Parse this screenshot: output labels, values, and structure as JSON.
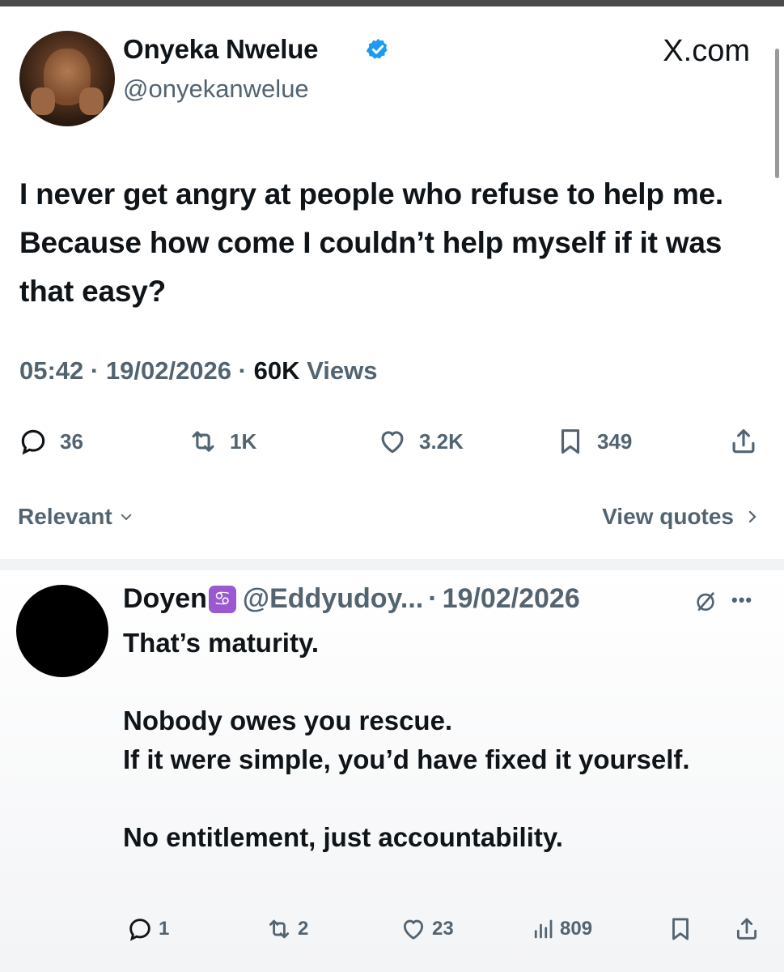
{
  "post": {
    "author_name": "Onyeka Nwelue",
    "handle": "@onyekanwelue",
    "site": "X.com",
    "text": "I never get angry at people who refuse to help me. Because how come I couldn’t help myself if it was that easy?",
    "time": "05:42",
    "date": "19/02/2026",
    "views_count": "60K",
    "views_label": "Views",
    "separator": "·",
    "actions": {
      "replies": "36",
      "reposts": "1K",
      "likes": "3.2K",
      "bookmarks": "349"
    },
    "sort_label": "Relevant",
    "view_quotes_label": "View quotes"
  },
  "reply": {
    "author_name": "Doyen",
    "badge": "♋",
    "handle": "@Eddyudoy...",
    "date": "19/02/2026",
    "text": "That’s maturity.\n\nNobody owes you rescue.\nIf it were simple, you’d have fixed it yourself.\n\nNo entitlement, just accountability.",
    "actions": {
      "replies": "1",
      "reposts": "2",
      "likes": "23",
      "views": "809"
    }
  },
  "colors": {
    "text_primary": "#0f1419",
    "text_secondary": "#536471",
    "verified_blue": "#1d9bf0",
    "badge_purple": "#9b59d0"
  },
  "icons": [
    "verified-badge-icon",
    "reply-icon",
    "repost-icon",
    "like-icon",
    "bookmark-icon",
    "share-icon",
    "chevron-down-icon",
    "chevron-right-icon",
    "grok-icon",
    "more-icon",
    "views-icon"
  ]
}
